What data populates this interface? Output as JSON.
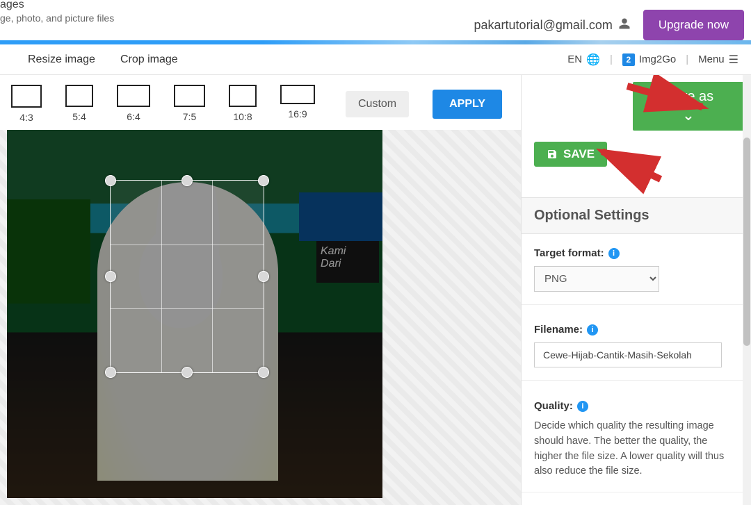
{
  "brand": {
    "title_partial": "ages",
    "subtitle_partial": "ge, photo, and picture files"
  },
  "header": {
    "email": "pakartutorial@gmail.com",
    "upgrade_label": "Upgrade now"
  },
  "nav": {
    "resize": "Resize image",
    "crop": "Crop image",
    "lang": "EN",
    "img2go": "Img2Go",
    "img2go_badge": "2",
    "menu": "Menu"
  },
  "ratios": {
    "r1": "4:3",
    "r2": "5:4",
    "r3": "6:4",
    "r4": "7:5",
    "r5": "10:8",
    "r6": "16:9",
    "custom": "Custom",
    "apply": "APPLY"
  },
  "poster": {
    "line1": "Kami",
    "line2": "Dari"
  },
  "right": {
    "save_as": "Save as",
    "save": "SAVE",
    "optional_settings": "Optional Settings",
    "target_format_label": "Target format:",
    "target_format_value": "PNG",
    "filename_label": "Filename:",
    "filename_value": "Cewe-Hijab-Cantik-Masih-Sekolah",
    "quality_label": "Quality:",
    "quality_desc": "Decide which quality the resulting image should have. The better the quality, the higher the file size. A lower quality will thus also reduce the file size."
  }
}
